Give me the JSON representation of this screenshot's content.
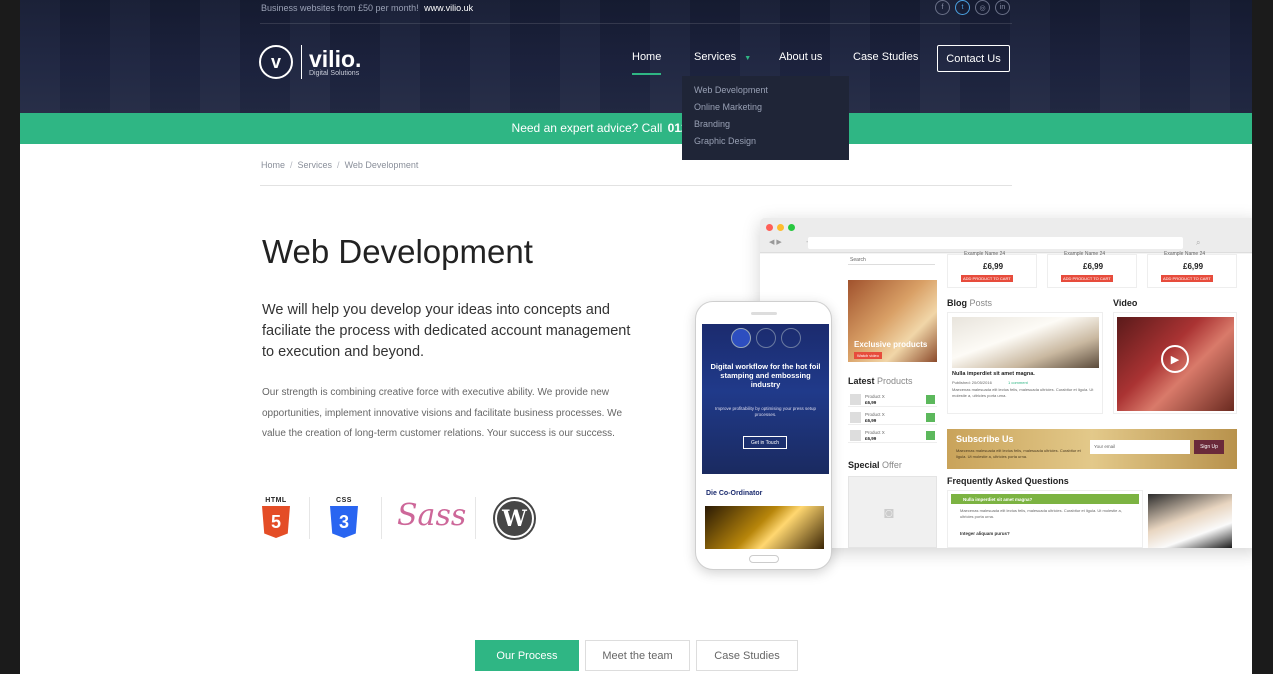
{
  "topbar": {
    "promo": "Business websites from £50 per month!",
    "promo_link": "www.vilio.uk"
  },
  "socials": [
    "facebook-icon",
    "twitter-icon",
    "instagram-icon",
    "linkedin-icon"
  ],
  "social_glyphs": [
    "f",
    "t",
    "◎",
    "in"
  ],
  "logo": {
    "mark": "v",
    "name": "vilio.",
    "tagline": "Digital Solutions"
  },
  "nav": {
    "home": "Home",
    "services": "Services",
    "about": "About us",
    "cases": "Case Studies",
    "contact": "Contact Us"
  },
  "dropdown": [
    "Web Development",
    "Online Marketing",
    "Branding",
    "Graphic Design"
  ],
  "greenbar": {
    "text": "Need an expert advice?  Call",
    "phone": "0123 111 1234",
    "tail": "or"
  },
  "breadcrumb": [
    "Home",
    "Services",
    "Web Development"
  ],
  "page": {
    "title": "Web Development",
    "lead": "We will help you develop your ideas into concepts and faciliate the process with dedicated account management to execution and beyond.",
    "body": "Our strength is combining creative force with executive ability. We provide new opportunities, implement innovative visions and facilitate business processes. We value the creation of long-term customer relations. Your success is our success."
  },
  "tech": {
    "html_label": "HTML",
    "html_num": "5",
    "css_label": "CSS",
    "css_num": "3",
    "sass": "Sass",
    "wp": "W"
  },
  "mockup": {
    "search": "Search",
    "product_name": "Example Name 24",
    "product_price": "£6,99",
    "add_btn": "ADD PRODUCT TO CART",
    "exclusive": "Exclusive products",
    "watch": "Watch video",
    "blog": "Blog",
    "posts": "Posts",
    "video": "Video",
    "post_title": "Nulla imperdiet sit amet magna.",
    "post_meta": "Published: 20/05/2016",
    "post_comments": "1 comment",
    "lorem": "Maecenas malesuada elit lectus felis, malesuada ultricies. Curabitur et ligula. Ut molestie a, ultricies porta urna.",
    "latest": "Latest",
    "latest_span": "Products",
    "mini_product": "Product X",
    "mini_price": "£6,99",
    "subscribe": "Subscribe Us",
    "subscribe_text": "Maecenas malesuada elit lectus felis, malesuada ultricies. Curabitur et ligula. Ut molestie a, ultricies porta urna.",
    "email_ph": "Your email",
    "signup": "Sign Up",
    "special": "Special",
    "special_span": "Offer",
    "faq": "Frequently Asked Questions",
    "faq_q1": "Nulla imperdiet sit amet magna?",
    "faq_q2": "Integer aliquam purus?"
  },
  "phone": {
    "headline": "Digital workflow for the hot foil stamping and embossing industry",
    "sub": "Improve profitability by optimising your press setup processes.",
    "cta": "Get in Touch",
    "section": "Die Co-Ordinator"
  },
  "tabs": [
    "Our Process",
    "Meet the team",
    "Case Studies"
  ],
  "colors": {
    "accent": "#2fb684",
    "hero": "#1d2440",
    "dropdown": "#1f2537"
  }
}
